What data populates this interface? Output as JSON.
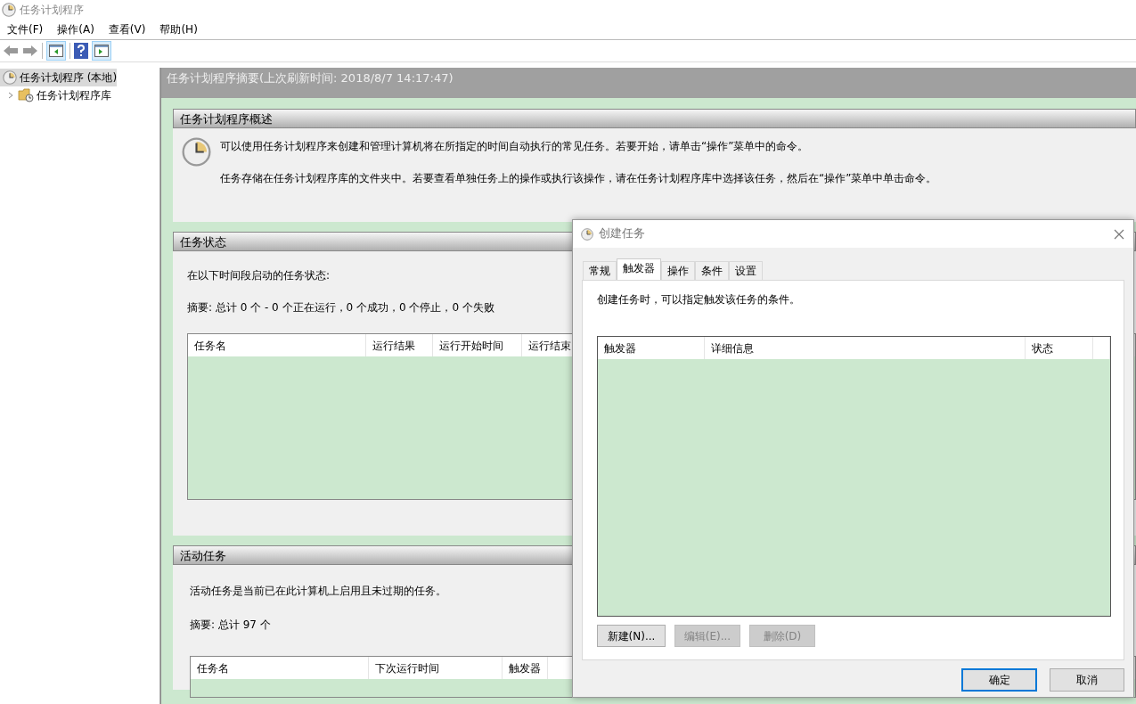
{
  "window": {
    "title": "任务计划程序"
  },
  "menu": [
    "文件(F)",
    "操作(A)",
    "查看(V)",
    "帮助(H)"
  ],
  "tree": [
    {
      "label": "任务计划程序 (本地)",
      "selected": true,
      "children": [
        {
          "label": "任务计划程序库",
          "selected": false,
          "expanded": false
        }
      ]
    }
  ],
  "panel": {
    "title": "任务计划程序摘要(上次刷新时间: 2018/8/7 14:17:47)"
  },
  "overview": {
    "title": "任务计划程序概述",
    "paragraphs": [
      "可以使用任务计划程序来创建和管理计算机将在所指定的时间自动执行的常见任务。若要开始，请单击“操作”菜单中的命令。",
      "任务存储在任务计划程序库的文件夹中。若要查看单独任务上的操作或执行该操作，请在任务计划程序库中选择该任务，然后在“操作”菜单中单击命令。"
    ]
  },
  "status": {
    "title": "任务状态",
    "lines": [
      "在以下时间段启动的任务状态:",
      "摘要: 总计 0 个 - 0 个正在运行，0 个成功，0 个停止，0 个失败"
    ],
    "columns": [
      "任务名",
      "运行结果",
      "运行开始时间",
      "运行结束"
    ]
  },
  "active": {
    "title": "活动任务",
    "lines": [
      "活动任务是当前已在此计算机上启用且未过期的任务。",
      "摘要: 总计 97 个"
    ],
    "columns": [
      "任务名",
      "下次运行时间",
      "触发器"
    ]
  },
  "dialog": {
    "title": "创建任务",
    "tabs": [
      {
        "label": "常规",
        "selected": false
      },
      {
        "label": "触发器",
        "selected": true
      },
      {
        "label": "操作",
        "selected": false
      },
      {
        "label": "条件",
        "selected": false
      },
      {
        "label": "设置",
        "selected": false
      }
    ],
    "description": "创建任务时，可以指定触发该任务的条件。",
    "columns": [
      "触发器",
      "详细信息",
      "状态"
    ],
    "buttons": [
      {
        "label": "新建(N)...",
        "disabled": false
      },
      {
        "label": "编辑(E)...",
        "disabled": true
      },
      {
        "label": "删除(D)",
        "disabled": true
      }
    ],
    "footer_buttons": [
      {
        "label": "确定",
        "default": true
      },
      {
        "label": "取消",
        "default": false
      }
    ]
  }
}
